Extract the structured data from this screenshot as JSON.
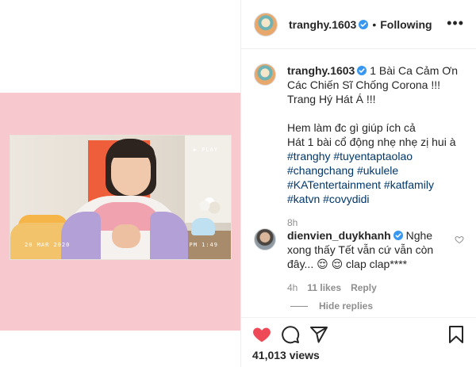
{
  "post": {
    "username": "tranghy.1603",
    "follow_status": "Following",
    "more_label": "•••"
  },
  "video": {
    "overlay_play": "▶ PLAY",
    "overlay_date": "20 MAR 2020",
    "overlay_time": "PM 1:49"
  },
  "caption": {
    "username": "tranghy.1603",
    "title": "1 Bài Ca Cảm Ơn Các Chiến Sĩ Chống Corona !!! Trang Hý Hát Á !!!",
    "line1": "Hem làm đc gì giúp ích cả",
    "line2": "Hát 1 bài cổ động nhẹ nhẹ zị hui à",
    "hashtags": [
      "#tranghy",
      "#tuyentaptaolao",
      "#changchang",
      "#ukulele",
      "#KATentertainment",
      "#katfamily",
      "#katvn",
      "#covydidi"
    ],
    "time": "8h"
  },
  "comment": {
    "username": "dienvien_duykhanh",
    "text": "Nghe xong thấy Tết vẫn cứ vẫn còn đây... 😌 😌  clap clap****",
    "time": "4h",
    "likes": "11 likes",
    "reply": "Reply",
    "hide_replies": "Hide replies"
  },
  "stats": {
    "views": "41,013 views"
  },
  "colors": {
    "like_red": "#ed4956",
    "verified_blue": "#3897f0",
    "link_blue": "#00376b",
    "muted_gray": "#8e8e8e",
    "frame_pink": "#f7c9cf"
  },
  "icons": [
    "verified-icon",
    "more-icon",
    "heart-icon",
    "comment-icon",
    "share-icon",
    "bookmark-icon",
    "heart-outline-icon"
  ]
}
